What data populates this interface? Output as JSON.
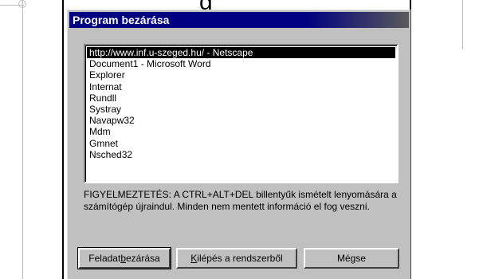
{
  "page": {
    "heading_fragment": "g"
  },
  "dialog": {
    "title": "Program bezárása",
    "tasks": [
      "http://www.inf.u-szeged.hu/ - Netscape",
      "Document1 - Microsoft Word",
      "Explorer",
      "Internat",
      "Rundll",
      "Systray",
      "Navapw32",
      "Mdm",
      "Gmnet",
      "Nsched32"
    ],
    "selected_index": 0,
    "warning": "FIGYELMEZTETÉS: A CTRL+ALT+DEL billentyűk ismételt lenyomására a számítógép újraindul. Minden nem mentett információ el fog veszni.",
    "buttons": {
      "end_task": {
        "pre": "Feladat ",
        "accel": "b",
        "post": "ezárása"
      },
      "shutdown": {
        "pre": "",
        "accel": "K",
        "post": "ilépés a rendszerből"
      },
      "cancel": {
        "label": "Mégse"
      }
    }
  },
  "colors": {
    "title_bar": "#000080",
    "dialog_face": "#c0c0c0",
    "selection": "#000000"
  }
}
